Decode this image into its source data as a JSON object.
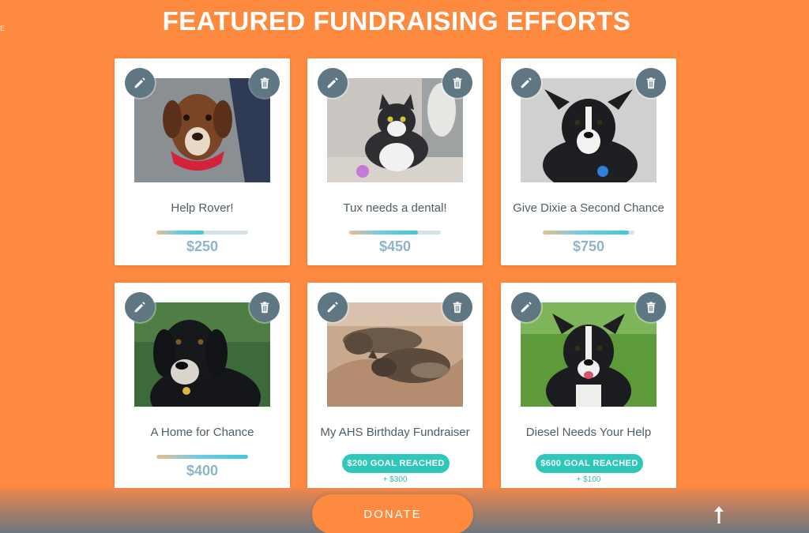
{
  "edge_text": "E",
  "header": {
    "title": "FEATURED FUNDRAISING EFFORTS"
  },
  "cards": [
    {
      "title": "Help Rover!",
      "amount": "$250",
      "progress": 0.52,
      "photo": "dog-photo"
    },
    {
      "title": "Tux needs a dental!",
      "amount": "$450",
      "progress": 0.75,
      "photo": "cat-photo"
    },
    {
      "title": "Give Dixie a Second Chance",
      "amount": "$750",
      "progress": 0.94,
      "photo": "puppy-photo"
    },
    {
      "title": "A Home for Chance",
      "amount": "$400",
      "progress": 1.0,
      "photo": "dog-photo"
    },
    {
      "title": "My AHS Birthday Fundraiser",
      "goal_badge": "$200 GOAL REACHED",
      "goal_extra": "+ $300",
      "photo": "cats-sleeping-photo"
    },
    {
      "title": "Diesel Needs Your Help",
      "goal_badge": "$600 GOAL REACHED",
      "goal_extra": "+ $100",
      "photo": "dog-in-grass-photo"
    }
  ],
  "footer": {
    "donate_label": "DONATE"
  },
  "icons": {
    "edit": "pencil-icon",
    "delete": "trash-icon",
    "scroll_top": "arrow-up-icon"
  },
  "colors": {
    "background": "#fd8a3f",
    "button_dark": "#5f7683",
    "goal_badge": "#2fc7b9",
    "amount_text": "#8fb4c9"
  }
}
